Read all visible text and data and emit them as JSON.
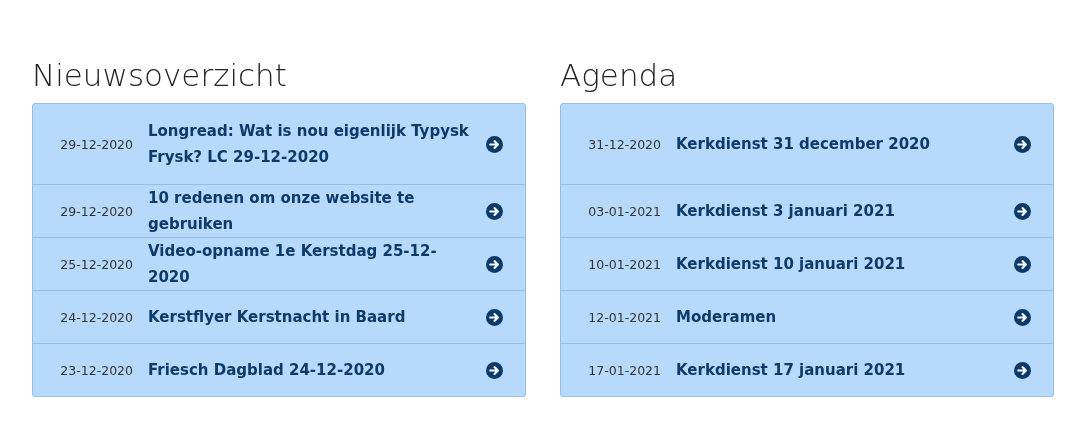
{
  "sections": [
    {
      "title": "Nieuwsoverzicht",
      "items": [
        {
          "date": "29-12-2020",
          "title": "Longread: Wat is nou eigenlijk Typysk Frysk? LC 29-12-2020"
        },
        {
          "date": "29-12-2020",
          "title": "10 redenen om onze website te gebruiken"
        },
        {
          "date": "25-12-2020",
          "title": "Video-opname 1e Kerstdag 25-12-2020"
        },
        {
          "date": "24-12-2020",
          "title": "Kerstflyer Kerstnacht in Baard"
        },
        {
          "date": "23-12-2020",
          "title": "Friesch Dagblad 24-12-2020"
        }
      ]
    },
    {
      "title": "Agenda",
      "items": [
        {
          "date": "31-12-2020",
          "title": "Kerkdienst 31 december 2020"
        },
        {
          "date": "03-01-2021",
          "title": "Kerkdienst 3 januari 2021"
        },
        {
          "date": "10-01-2021",
          "title": "Kerkdienst 10 januari 2021"
        },
        {
          "date": "12-01-2021",
          "title": "Moderamen"
        },
        {
          "date": "17-01-2021",
          "title": "Kerkdienst 17 januari 2021"
        }
      ]
    }
  ]
}
